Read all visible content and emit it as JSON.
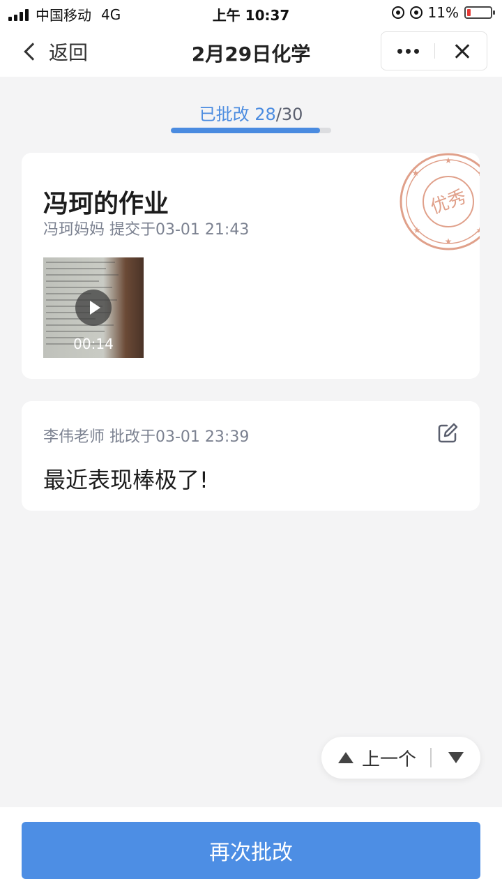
{
  "status_bar": {
    "carrier": "中国移动",
    "network": "4G",
    "time": "上午 10:37",
    "battery": "11%"
  },
  "nav": {
    "back_label": "返回",
    "title": "2月29日化学"
  },
  "progress": {
    "label": "已批改",
    "done": "28",
    "separator_total": "/30",
    "fraction": 0.93
  },
  "work": {
    "title": "冯珂的作业",
    "meta": "冯珂妈妈 提交于03-01 21:43",
    "video_duration": "00:14",
    "stamp_text": "优秀"
  },
  "comment": {
    "meta": "李伟老师 批改于03-01 23:39",
    "text": "最近表现棒极了!"
  },
  "float_nav": {
    "prev_label": "上一个"
  },
  "bottom": {
    "primary_label": "再次批改"
  },
  "colors": {
    "accent": "#4a8be0",
    "button": "#4d8ee4",
    "stamp": "#e0a08a"
  }
}
